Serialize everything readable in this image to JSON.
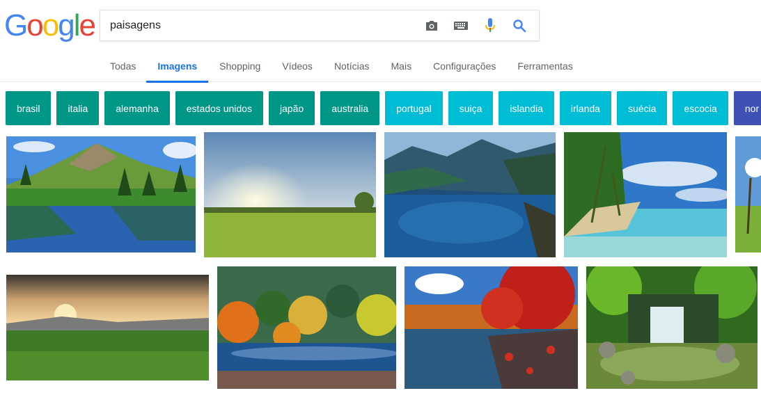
{
  "logo": {
    "letters": [
      "G",
      "o",
      "o",
      "g",
      "l",
      "e"
    ],
    "colors": [
      "#4285F4",
      "#EA4335",
      "#FBBC05",
      "#4285F4",
      "#34A853",
      "#EA4335"
    ]
  },
  "search": {
    "value": "paisagens"
  },
  "icons": [
    "camera-icon",
    "keyboard-icon",
    "microphone-icon",
    "search-icon"
  ],
  "tabs": [
    {
      "label": "Todas",
      "active": false
    },
    {
      "label": "Imagens",
      "active": true
    },
    {
      "label": "Shopping",
      "active": false
    },
    {
      "label": "Vídeos",
      "active": false
    },
    {
      "label": "Notícias",
      "active": false
    },
    {
      "label": "Mais",
      "active": false
    },
    {
      "label": "Configurações",
      "active": false
    },
    {
      "label": "Ferramentas",
      "active": false
    }
  ],
  "chips": [
    {
      "label": "brasil",
      "color": "#009688"
    },
    {
      "label": "italia",
      "color": "#009688"
    },
    {
      "label": "alemanha",
      "color": "#009688"
    },
    {
      "label": "estados unidos",
      "color": "#009688"
    },
    {
      "label": "japão",
      "color": "#009688"
    },
    {
      "label": "australia",
      "color": "#009688"
    },
    {
      "label": "portugal",
      "color": "#00bcd4"
    },
    {
      "label": "suiça",
      "color": "#00bcd4"
    },
    {
      "label": "islandia",
      "color": "#00bcd4"
    },
    {
      "label": "irlanda",
      "color": "#00bcd4"
    },
    {
      "label": "suécia",
      "color": "#00bcd4"
    },
    {
      "label": "escocia",
      "color": "#00bcd4"
    },
    {
      "label": "nor",
      "color": "#3f51b5"
    }
  ]
}
